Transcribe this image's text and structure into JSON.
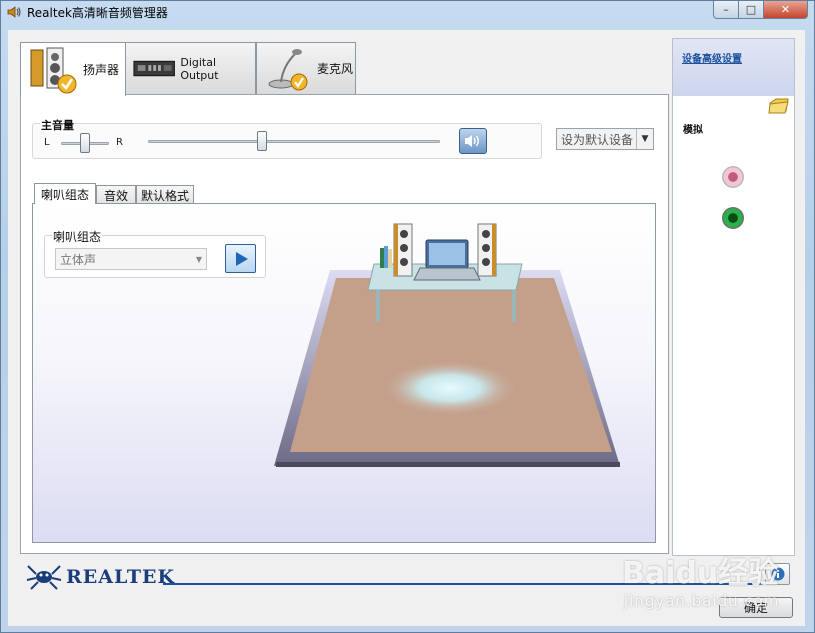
{
  "window": {
    "title": "Realtek高清晰音频管理器",
    "minimize_glyph": "–",
    "maximize_glyph": "□",
    "close_glyph": "✕"
  },
  "main_tabs": [
    {
      "label": "扬声器",
      "icon": "speaker-icon",
      "active": true
    },
    {
      "label": "Digital Output",
      "icon": "digital-output-icon",
      "active": false
    },
    {
      "label": "麦克风",
      "icon": "microphone-icon",
      "active": false
    }
  ],
  "volume": {
    "label": "主音量",
    "left_label": "L",
    "right_label": "R",
    "balance_level": 0.5,
    "volume_level": 0.39,
    "mute_icon": "speaker-volume-icon"
  },
  "default_device": {
    "label": "设为默认设备"
  },
  "sub_tabs": [
    {
      "label": "喇叭组态",
      "active": true
    },
    {
      "label": "音效",
      "active": false
    },
    {
      "label": "默认格式",
      "active": false
    }
  ],
  "speaker_config": {
    "group_label": "喇叭组态",
    "selected": "立体声",
    "play_icon": "play-icon"
  },
  "right_panel": {
    "advanced_link": "设备高级设置",
    "folder_icon": "folder-icon",
    "analog_label": "模拟",
    "jacks": [
      {
        "name": "pink-jack",
        "color": "#e6b3c4"
      },
      {
        "name": "green-jack",
        "color": "#1fa83b"
      }
    ]
  },
  "footer": {
    "brand": "REALTEK",
    "info_icon": "info-icon",
    "ok_label": "确定"
  },
  "watermark": {
    "line1": "Baidu经验",
    "line2": "jingyan.baidu.com"
  },
  "colors": {
    "accent": "#1f4f9d",
    "link": "#1b4f9c"
  }
}
